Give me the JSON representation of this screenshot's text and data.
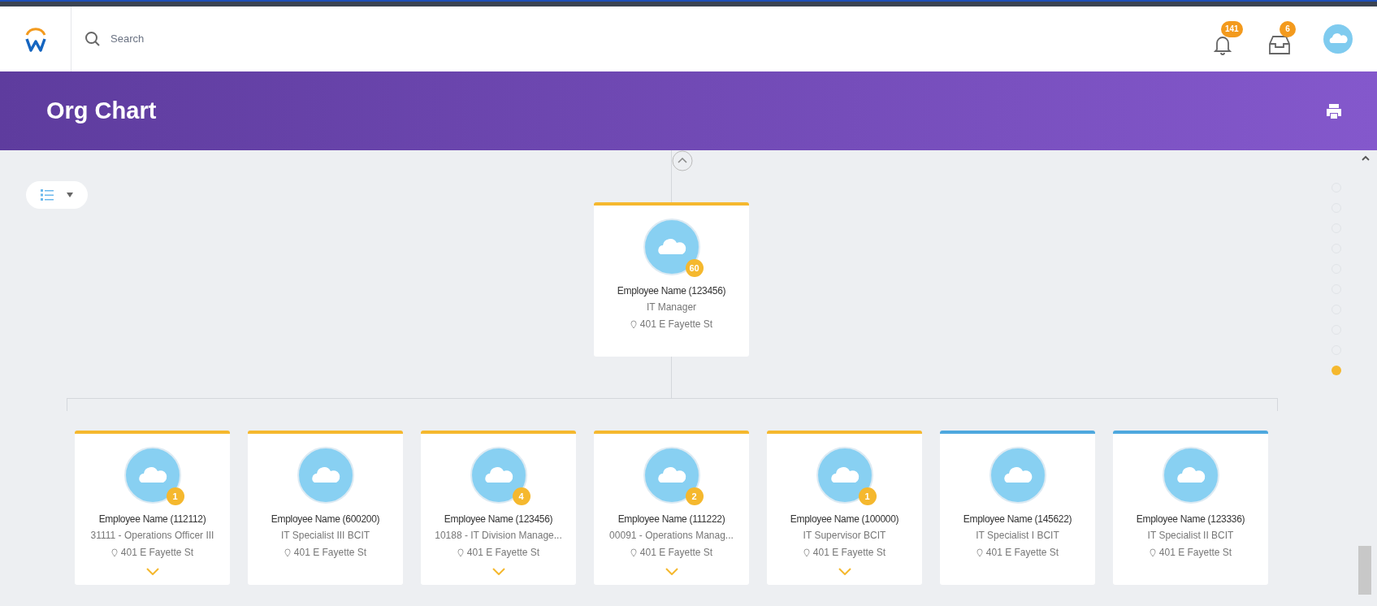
{
  "search": {
    "placeholder": "Search"
  },
  "notifications": {
    "count": "141"
  },
  "inbox": {
    "count": "6"
  },
  "header": {
    "title": "Org Chart"
  },
  "manager": {
    "name": "Employee Name (123456)",
    "title": "IT Manager",
    "location": "401 E Fayette St",
    "count": "60",
    "color": "#f5b82e",
    "expandable": false
  },
  "reports": [
    {
      "name": "Employee Name (112112)",
      "title": "31111 - Operations Officer III",
      "location": "401 E Fayette St",
      "count": "1",
      "color": "#f5b82e",
      "expandable": true
    },
    {
      "name": "Employee Name (600200)",
      "title": "IT Specialist III BCIT",
      "location": "401 E Fayette St",
      "color": "#f5b82e",
      "expandable": false
    },
    {
      "name": "Employee Name (123456)",
      "title": "10188 - IT Division Manage...",
      "location": "401 E Fayette St",
      "count": "4",
      "color": "#f5b82e",
      "expandable": true
    },
    {
      "name": "Employee Name (111222)",
      "title": "00091 - Operations Manag...",
      "location": "401 E Fayette St",
      "count": "2",
      "color": "#f5b82e",
      "expandable": true
    },
    {
      "name": "Employee Name (100000)",
      "title": "IT Supervisor BCIT",
      "location": "401 E Fayette St",
      "count": "1",
      "color": "#f5b82e",
      "expandable": true
    },
    {
      "name": "Employee Name (145622)",
      "title": "IT Specialist I BCIT",
      "location": "401 E Fayette St",
      "color": "#4ea8de",
      "expandable": false
    },
    {
      "name": "Employee Name (123336)",
      "title": "IT Specialist II BCIT",
      "location": "401 E Fayette St",
      "color": "#4ea8de",
      "expandable": false
    }
  ],
  "levels": [
    {
      "selected": false
    },
    {
      "selected": false
    },
    {
      "selected": false
    },
    {
      "selected": false
    },
    {
      "selected": false
    },
    {
      "selected": false
    },
    {
      "selected": false
    },
    {
      "selected": false
    },
    {
      "selected": false
    },
    {
      "selected": true
    }
  ]
}
